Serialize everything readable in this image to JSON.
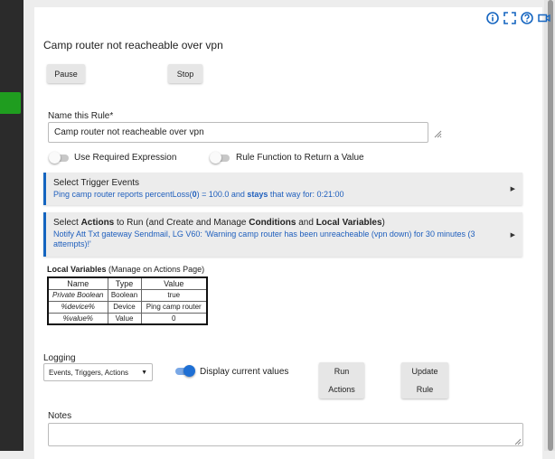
{
  "header": {
    "title": "Camp router not reacheable over vpn",
    "icons": [
      "info-icon",
      "fullscreen-icon",
      "help-icon",
      "video-icon",
      "mobile-icon"
    ]
  },
  "controls": {
    "pause_label": "Pause",
    "stop_label": "Stop"
  },
  "name_field": {
    "label": "Name this Rule*",
    "value": "Camp router not reacheable over vpn"
  },
  "toggles": {
    "required_expression": {
      "label": "Use Required Expression",
      "on": false
    },
    "rule_function": {
      "label": "Rule Function to Return a Value",
      "on": false
    }
  },
  "trigger_panel": {
    "title": "Select Trigger Events",
    "desc_pre": "Ping camp router reports percentLoss(",
    "desc_zero": "0",
    "desc_mid": ") = 100.0 and ",
    "desc_bold": "stays",
    "desc_post": " that way for: 0:21:00"
  },
  "actions_panel": {
    "t1": "Select ",
    "t2": "Actions",
    "t3": " to Run (and Create and Manage ",
    "t4": "Conditions",
    "t5": " and ",
    "t6": "Local Variables",
    "t7": ")",
    "desc": "Notify Att Txt gateway Sendmail, LG V60: 'Warning camp router has been unreacheable (vpn down) for 30 minutes (3 attempts)!'"
  },
  "local_variables": {
    "title": "Local Variables",
    "subtitle": " (Manage on Actions Page)",
    "headers": [
      "Name",
      "Type",
      "Value"
    ],
    "rows": [
      [
        "Private Boolean",
        "Boolean",
        "true"
      ],
      [
        "%device%",
        "Device",
        "Ping camp router"
      ],
      [
        "%value%",
        "Value",
        "0"
      ]
    ]
  },
  "logging": {
    "label": "Logging",
    "selected": "Events, Triggers, Actions",
    "display_label": "Display current values",
    "display_on": true
  },
  "buttons": {
    "run_line1": "Run",
    "run_line2": "Actions",
    "update_line1": "Update",
    "update_line2": "Rule"
  },
  "notes": {
    "label": "Notes",
    "value": ""
  },
  "colors": {
    "accent": "#1565c0",
    "link": "#1f5fbd",
    "sidebar_active": "#1f9d1f"
  }
}
